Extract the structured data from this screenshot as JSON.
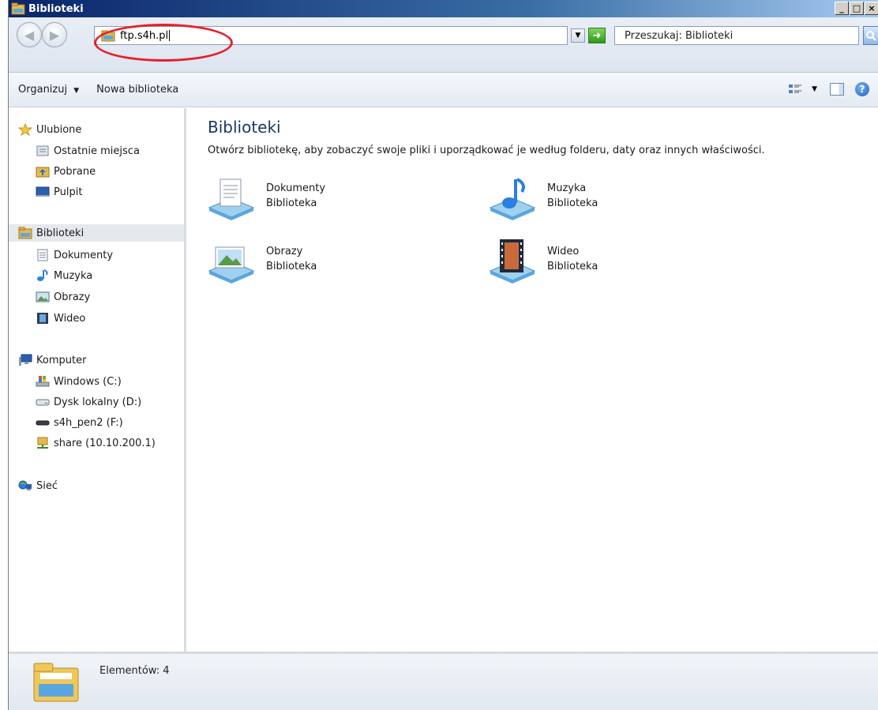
{
  "window": {
    "title": "Biblioteki",
    "controls": {
      "minimize": "_",
      "maximize": "□",
      "close": "×"
    }
  },
  "address_bar": {
    "value": "ftp.s4h.pl",
    "highlight_color": "#e6202a"
  },
  "search": {
    "placeholder": "Przeszukaj: Biblioteki"
  },
  "commands": {
    "organize": "Organizuj",
    "new_library": "Nowa biblioteka"
  },
  "nav": {
    "favorites": {
      "label": "Ulubione",
      "items": [
        "Ostatnie miejsca",
        "Pobrane",
        "Pulpit"
      ]
    },
    "libraries": {
      "label": "Biblioteki",
      "items": [
        "Dokumenty",
        "Muzyka",
        "Obrazy",
        "Wideo"
      ]
    },
    "computer": {
      "label": "Komputer",
      "items": [
        "Windows (C:)",
        "Dysk lokalny (D:)",
        "s4h_pen2 (F:)",
        "share (10.10.200.1)"
      ]
    },
    "network": {
      "label": "Sieć"
    }
  },
  "content": {
    "title": "Biblioteki",
    "subtitle": "Otwórz bibliotekę, aby zobaczyć swoje pliki i uporządkować je według folderu, daty oraz innych właściwości.",
    "libraries": [
      {
        "name": "Dokumenty",
        "type": "Biblioteka",
        "icon": "documents-library-icon"
      },
      {
        "name": "Muzyka",
        "type": "Biblioteka",
        "icon": "music-library-icon"
      },
      {
        "name": "Obrazy",
        "type": "Biblioteka",
        "icon": "pictures-library-icon"
      },
      {
        "name": "Wideo",
        "type": "Biblioteka",
        "icon": "video-library-icon"
      }
    ]
  },
  "status": {
    "text": "Elementów: 4"
  }
}
